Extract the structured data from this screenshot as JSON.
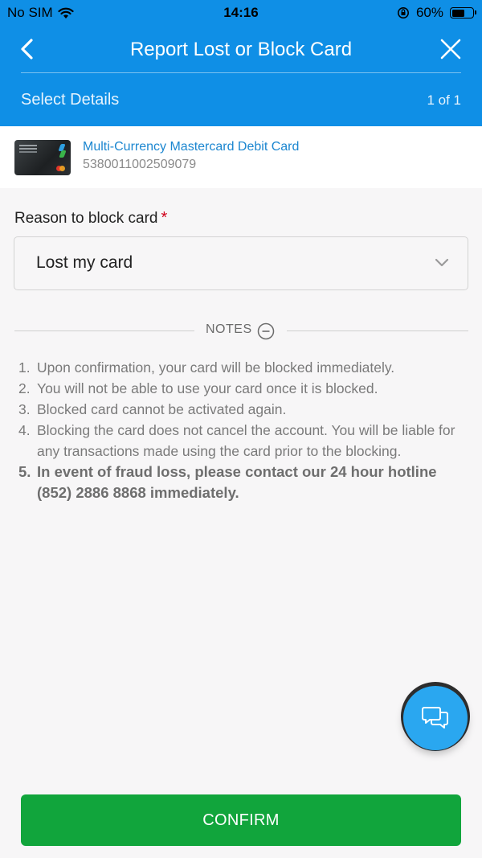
{
  "status_bar": {
    "carrier": "No SIM",
    "time": "14:16",
    "battery": "60%",
    "battery_level": 0.6
  },
  "header": {
    "title": "Report Lost or Block Card",
    "step_title": "Select Details",
    "step_count": "1 of 1"
  },
  "card": {
    "name": "Multi-Currency Mastercard Debit Card",
    "number": "5380011002509079"
  },
  "reason": {
    "label": "Reason to block card",
    "required_mark": "*",
    "selected": "Lost my card"
  },
  "notes": {
    "label": "NOTES",
    "items": [
      {
        "num": "1.",
        "text": "Upon confirmation, your card will be blocked immediately."
      },
      {
        "num": "2.",
        "text": "You will not be able to use your card once it is blocked."
      },
      {
        "num": "3.",
        "text": "Blocked card cannot be activated again."
      },
      {
        "num": "4.",
        "text": "Blocking the card does not cancel the account. You will be liable for any transactions made using the card prior to the blocking."
      },
      {
        "num": "5.",
        "text": "In event of fraud loss, please contact our 24 hour hotline (852) 2886 8868 immediately."
      }
    ]
  },
  "confirm_label": "CONFIRM",
  "colors": {
    "header_blue": "#0f8fe6",
    "link_blue": "#1b86d0",
    "confirm_green": "#11a53c",
    "required_red": "#d0021b",
    "fab_blue": "#2aa7f0"
  }
}
